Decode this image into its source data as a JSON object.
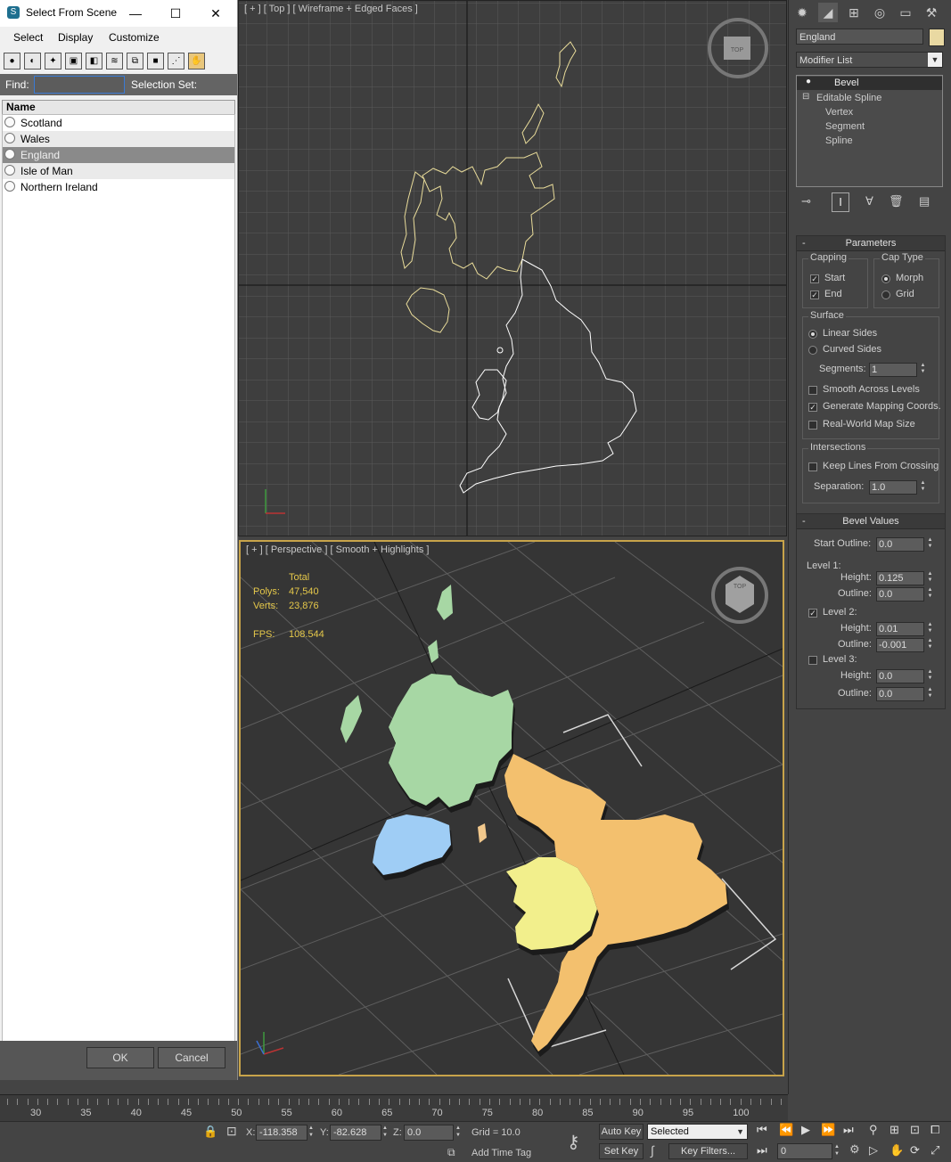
{
  "dialog": {
    "title": "Select From Scene",
    "window_buttons": {
      "minimize": "—",
      "maximize": "☐",
      "close": "✕"
    },
    "menu": [
      "Select",
      "Display",
      "Customize"
    ],
    "find_label": "Find:",
    "find_value": "",
    "selection_set_label": "Selection Set:",
    "column_header": "Name",
    "items": [
      "Scotland",
      "Wales",
      "England",
      "Isle of Man",
      "Northern Ireland"
    ],
    "selected_item": "England",
    "ok_label": "OK",
    "cancel_label": "Cancel"
  },
  "viewport_top": {
    "label": "[ + ] [ Top ] [ Wireframe + Edged Faces ]",
    "viewcube": "TOP"
  },
  "viewport_persp": {
    "label": "[ + ] [ Perspective ] [ Smooth + Highlights ]",
    "viewcube": "TOP",
    "stats": {
      "total_label": "Total",
      "polys_label": "Polys:",
      "polys": "47,540",
      "verts_label": "Verts:",
      "verts": "23,876",
      "fps_label": "FPS:",
      "fps": "108.544"
    },
    "region_colors": {
      "scotland": "#a7d7a4",
      "england": "#f3c06e",
      "wales": "#f2ef8c",
      "northern_ireland": "#9fcdf5",
      "isle_of_man": "#f2c88c"
    }
  },
  "command_panel": {
    "object_name": "England",
    "object_color": "#e9d9a2",
    "modifier_list": "Modifier List",
    "stack": [
      "Bevel",
      "Editable Spline",
      "Vertex",
      "Segment",
      "Spline"
    ],
    "parameters": {
      "title": "Parameters",
      "capping_label": "Capping",
      "start_label": "Start",
      "end_label": "End",
      "cap_type_label": "Cap Type",
      "morph_label": "Morph",
      "grid_label": "Grid",
      "surface_label": "Surface",
      "linear_sides_label": "Linear Sides",
      "curved_sides_label": "Curved Sides",
      "segments_label": "Segments:",
      "segments": "1",
      "smooth_across_levels": "Smooth Across Levels",
      "generate_mapping": "Generate Mapping Coords.",
      "real_world": "Real-World Map Size",
      "intersections_label": "Intersections",
      "keep_lines": "Keep Lines From Crossing",
      "separation_label": "Separation:",
      "separation": "1.0"
    },
    "bevel_values": {
      "title": "Bevel Values",
      "start_outline_label": "Start Outline:",
      "start_outline": "0.0",
      "level1_label": "Level 1:",
      "height_label": "Height:",
      "outline_label": "Outline:",
      "level1_height": "0.125",
      "level1_outline": "0.0",
      "level2_label": "Level 2:",
      "level2_height": "0.01",
      "level2_outline": "-0.001",
      "level3_label": "Level 3:",
      "level3_height": "0.0",
      "level3_outline": "0.0"
    }
  },
  "timeline": {
    "ticks": [
      "30",
      "35",
      "40",
      "45",
      "50",
      "55",
      "60",
      "65",
      "70",
      "75",
      "80",
      "85",
      "90",
      "95",
      "100"
    ]
  },
  "status": {
    "x_label": "X:",
    "x": "-118.358",
    "y_label": "Y:",
    "y": "-82.628",
    "z_label": "Z:",
    "z": "0.0",
    "grid": "Grid = 10.0",
    "add_time_tag": "Add Time Tag",
    "auto_key": "Auto Key",
    "set_key": "Set Key",
    "selected": "Selected",
    "key_filters": "Key Filters...",
    "frame": "0"
  }
}
